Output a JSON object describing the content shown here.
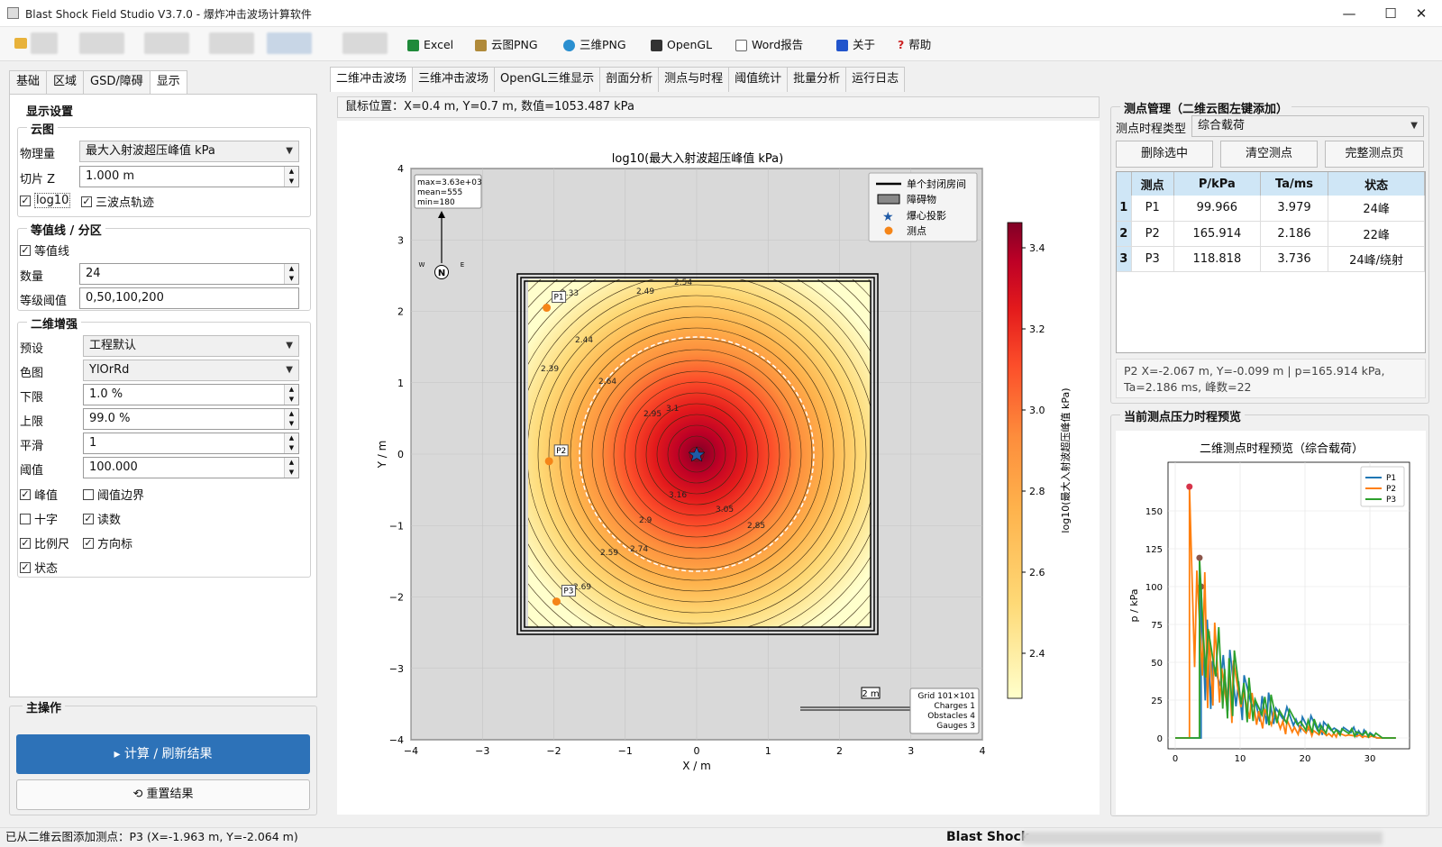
{
  "window": {
    "title": "Blast Shock Field Studio V3.7.0 - 爆炸冲击波场计算软件",
    "minimize": "—",
    "maximize": "☐",
    "close": "✕"
  },
  "toolbar": {
    "items": [
      {
        "label": "Excel",
        "icon": "excel-icon",
        "color": "#1f8a3a"
      },
      {
        "label": "云图PNG",
        "icon": "image-icon",
        "color": "#b08a3a"
      },
      {
        "label": "三维PNG",
        "icon": "globe-icon",
        "color": "#2a8fd0"
      },
      {
        "label": "OpenGL",
        "icon": "monitor-icon",
        "color": "#333333"
      },
      {
        "label": "Word报告",
        "icon": "document-icon",
        "color": "#666666"
      },
      {
        "label": "关于",
        "icon": "info-icon",
        "color": "#2255cc"
      },
      {
        "label": "帮助",
        "icon": "help-icon",
        "color": "#cc2222"
      }
    ]
  },
  "left": {
    "tabs": [
      "基础",
      "区域",
      "GSD/障碍",
      "显示"
    ],
    "display_group": "显示设置",
    "cloud": {
      "title": "云图",
      "quantity_label": "物理量",
      "quantity_value": "最大入射波超压峰值 kPa",
      "slice_label": "切片 Z",
      "slice_value": "1.000 m",
      "log10": "log10",
      "triple": "三波点轨迹"
    },
    "contour": {
      "title": "等值线 / 分区",
      "lines": "等值线",
      "count_label": "数量",
      "count_value": "24",
      "levels_label": "等级阈值",
      "levels_value": "0,50,100,200"
    },
    "enhance": {
      "title": "二维增强",
      "preset_label": "预设",
      "preset_value": "工程默认",
      "cmap_label": "色图",
      "cmap_value": "YlOrRd",
      "low_label": "下限",
      "low_value": "1.0 %",
      "high_label": "上限",
      "high_value": "99.0 %",
      "smooth_label": "平滑",
      "smooth_value": "1",
      "thr_label": "阈值",
      "thr_value": "100.000",
      "peak": "峰值",
      "thr_edge": "阈值边界",
      "cross": "十字",
      "reading": "读数",
      "scale": "比例尺",
      "compass": "方向标",
      "state": "状态"
    },
    "mainops": {
      "title": "主操作",
      "calc": "▸  计算 / 刷新结果",
      "reset": "⟲  重置结果"
    }
  },
  "center": {
    "tabs": [
      "二维冲击波场",
      "三维冲击波场",
      "OpenGL三维显示",
      "剖面分析",
      "测点与时程",
      "阈值统计",
      "批量分析",
      "运行日志"
    ],
    "mouse": "鼠标位置：X=0.4 m, Y=0.7 m, 数值=1053.487 kPa",
    "plot": {
      "title": "log10(最大入射波超压峰值 kPa)",
      "xlabel": "X / m",
      "ylabel": "Y / m",
      "ticks": [
        "−4",
        "−3",
        "−2",
        "−1",
        "0",
        "1",
        "2",
        "3",
        "4"
      ],
      "stats": [
        "max=3.63e+03",
        "mean=555",
        "min=180"
      ],
      "legend": [
        "单个封闭房间",
        "障碍物",
        "爆心投影",
        "测点"
      ],
      "colorbar_label": "log10(最大入射波超压峰值 kPa)",
      "colorbar_ticks": [
        "3.4",
        "3.2",
        "3.0",
        "2.8",
        "2.6",
        "2.4"
      ],
      "gauges": [
        {
          "name": "P1",
          "x": -2.1,
          "y": 2.05
        },
        {
          "name": "P2",
          "x": -2.067,
          "y": -0.099
        },
        {
          "name": "P3",
          "x": -1.963,
          "y": -2.064
        }
      ],
      "contour_labels": [
        "2.33",
        "2.49",
        "2.54",
        "2.44",
        "2.39",
        "2.64",
        "2.95",
        "3.1",
        "2.9",
        "2.74",
        "2.85",
        "3.05",
        "3.16",
        "2.59",
        "2.69"
      ],
      "scalebar": "2 m",
      "info": [
        "Grid 101×101",
        "Charges 1",
        "Obstacles 4",
        "Gauges 3"
      ],
      "compass": {
        "n": "N",
        "w": "W",
        "e": "E"
      }
    }
  },
  "right": {
    "gauge_title": "测点管理（二维云图左键添加）",
    "type_label": "测点时程类型",
    "type_value": "综合载荷",
    "buttons": [
      "删除选中",
      "清空测点",
      "完整测点页"
    ],
    "headers": [
      "测点",
      "P/kPa",
      "Ta/ms",
      "状态"
    ],
    "rows": [
      {
        "n": "1",
        "name": "P1",
        "p": "99.966",
        "ta": "3.979",
        "st": "24峰"
      },
      {
        "n": "2",
        "name": "P2",
        "p": "165.914",
        "ta": "2.186",
        "st": "22峰"
      },
      {
        "n": "3",
        "name": "P3",
        "p": "118.818",
        "ta": "3.736",
        "st": "24峰/绕射"
      }
    ],
    "sel_info_1": "P2  X=-2.067 m, Y=-0.099 m  |  p=165.914 kPa,",
    "sel_info_2": "Ta=2.186 ms, 峰数=22",
    "preview_title": "当前测点压力时程预览",
    "chart": {
      "title": "二维测点时程预览（综合载荷）",
      "ylabel": "p / kPa",
      "yticks": [
        "150",
        "125",
        "100",
        "75",
        "50",
        "25",
        "0"
      ],
      "xticks": [
        "0",
        "10",
        "20",
        "30"
      ],
      "legend": [
        "P1",
        "P2",
        "P3"
      ],
      "colors": [
        "#1f77b4",
        "#ff7f0e",
        "#2ca02c"
      ]
    }
  },
  "status": {
    "left": "已从二维云图添加测点：P3 (X=-1.963 m, Y=-2.064 m)",
    "right": "Blast Shock"
  }
}
